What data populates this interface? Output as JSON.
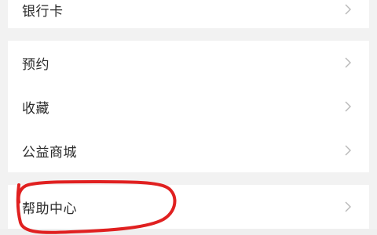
{
  "sections": {
    "bank": {
      "items": [
        {
          "label": "银行卡"
        }
      ]
    },
    "services": {
      "items": [
        {
          "label": "预约"
        },
        {
          "label": "收藏"
        },
        {
          "label": "公益商城"
        }
      ]
    },
    "help": {
      "items": [
        {
          "label": "帮助中心"
        }
      ]
    }
  },
  "colors": {
    "background": "#f2f2f2",
    "row_background": "#ffffff",
    "text": "#2b2b2b",
    "chevron": "#b8b8b8",
    "annotation": "#e02020"
  },
  "icons": {
    "row_chevron": "chevron-right-icon"
  }
}
